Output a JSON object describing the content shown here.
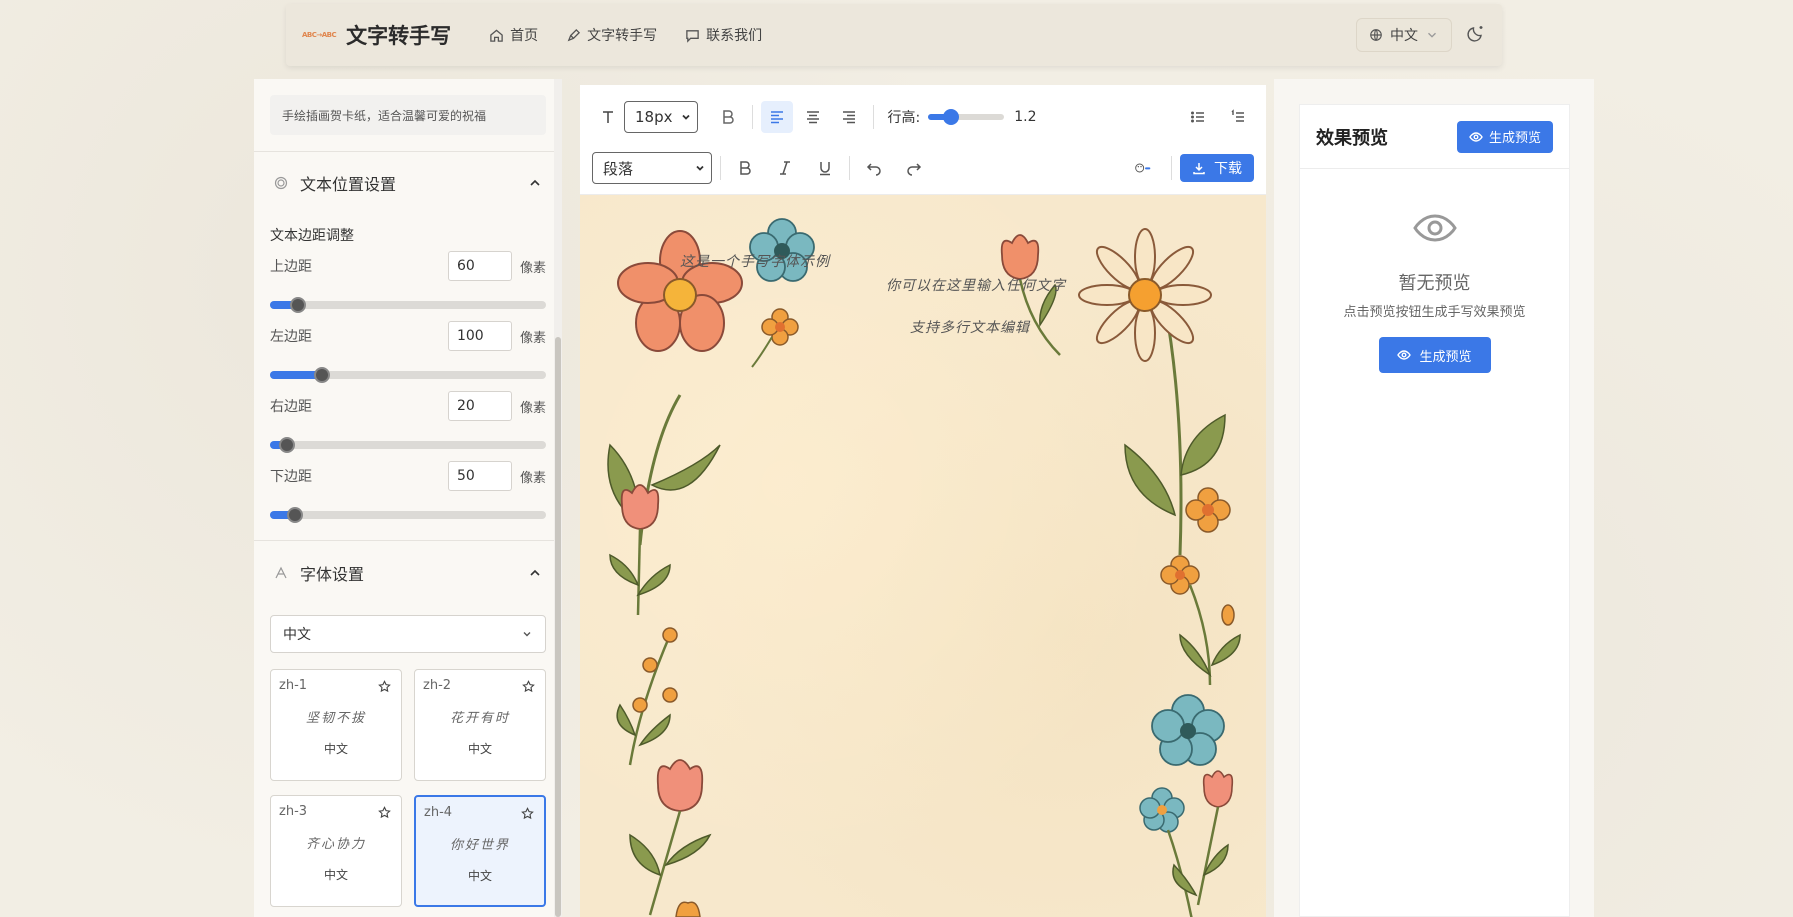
{
  "app": {
    "logo_text": "ABC→ABC",
    "title": "文字转手写"
  },
  "nav": {
    "items": [
      {
        "label": "首页",
        "icon": "home-icon"
      },
      {
        "label": "文字转手写",
        "icon": "pen-icon"
      },
      {
        "label": "联系我们",
        "icon": "message-icon"
      }
    ],
    "language": "中文"
  },
  "left_panel": {
    "template_desc": "手绘插画贺卡纸，适合温馨可爱的祝福",
    "position_section": {
      "title": "文本位置设置",
      "subtitle": "文本边距调整",
      "fields": [
        {
          "label": "上边距",
          "value": "60",
          "unit": "像素",
          "fraction": 0.1
        },
        {
          "label": "左边距",
          "value": "100",
          "unit": "像素",
          "fraction": 0.19
        },
        {
          "label": "右边距",
          "value": "20",
          "unit": "像素",
          "fraction": 0.06
        },
        {
          "label": "下边距",
          "value": "50",
          "unit": "像素",
          "fraction": 0.09
        }
      ]
    },
    "font_section": {
      "title": "字体设置",
      "language_select": "中文",
      "fonts": [
        {
          "id": "zh-1",
          "sample": "坚韧不拔",
          "lang": "中文",
          "selected": false
        },
        {
          "id": "zh-2",
          "sample": "花开有时",
          "lang": "中文",
          "selected": false
        },
        {
          "id": "zh-3",
          "sample": "齐心协力",
          "lang": "中文",
          "selected": false
        },
        {
          "id": "zh-4",
          "sample": "你好世界",
          "lang": "中文",
          "selected": true
        }
      ]
    }
  },
  "toolbar": {
    "font_size": "18px",
    "line_height_label": "行高:",
    "line_height_value": "1.2",
    "line_height_fraction": 0.3,
    "block_format": "段落",
    "download_label": "下载"
  },
  "canvas": {
    "lines": [
      "这是一个手写字体示例",
      "你可以在这里输入任何文字",
      "支持多行文本编辑"
    ]
  },
  "preview": {
    "title": "效果预览",
    "button_label": "生成预览",
    "empty_title": "暂无预览",
    "empty_desc": "点击预览按钮生成手写效果预览",
    "empty_button_label": "生成预览"
  },
  "colors": {
    "accent": "#3b78e7",
    "paper": "#f7e8cc"
  }
}
